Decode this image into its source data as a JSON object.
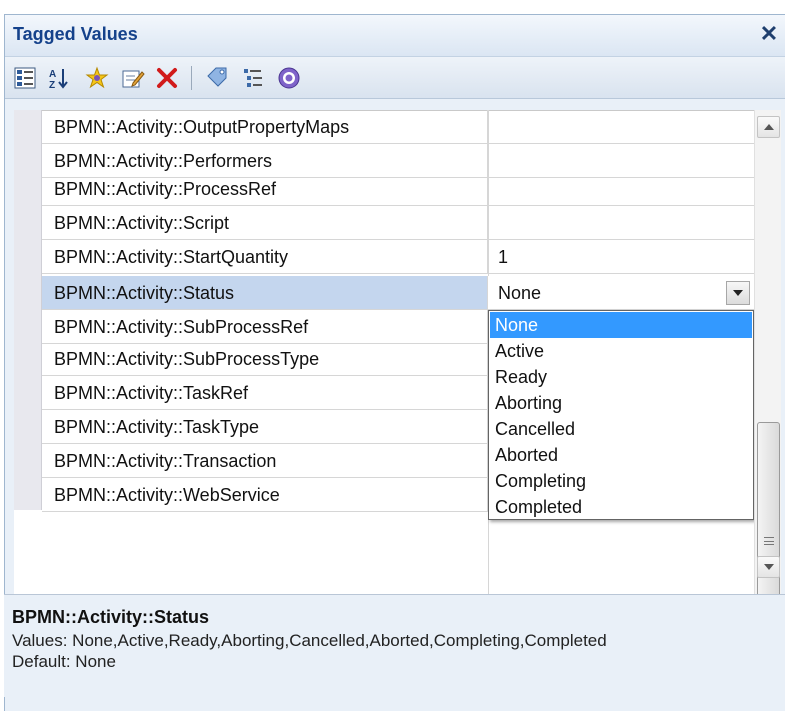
{
  "window": {
    "title": "Tagged Values",
    "close_icon": "close-icon"
  },
  "toolbar": {
    "buttons": [
      {
        "name": "categorized-view-icon"
      },
      {
        "name": "sort-alphabetical-icon"
      },
      {
        "name": "new-tag-icon"
      },
      {
        "name": "edit-tag-icon"
      },
      {
        "name": "delete-tag-icon"
      },
      {
        "name": "tag-properties-icon"
      },
      {
        "name": "show-inherited-icon"
      },
      {
        "name": "help-icon"
      }
    ]
  },
  "rows": [
    {
      "name": "BPMN::Activity::OutputPropertyMaps",
      "value": ""
    },
    {
      "name": "BPMN::Activity::Performers",
      "value": ""
    },
    {
      "name": "BPMN::Activity::ProcessRef",
      "value": ""
    },
    {
      "name": "BPMN::Activity::Script",
      "value": ""
    },
    {
      "name": "BPMN::Activity::StartQuantity",
      "value": "1"
    },
    {
      "name": "BPMN::Activity::Status",
      "value": "None"
    },
    {
      "name": "BPMN::Activity::SubProcessRef",
      "value": ""
    },
    {
      "name": "BPMN::Activity::SubProcessType",
      "value": ""
    },
    {
      "name": "BPMN::Activity::TaskRef",
      "value": ""
    },
    {
      "name": "BPMN::Activity::TaskType",
      "value": ""
    },
    {
      "name": "BPMN::Activity::Transaction",
      "value": ""
    },
    {
      "name": "BPMN::Activity::WebService",
      "value": ""
    }
  ],
  "status_combo": {
    "selected": "None"
  },
  "dropdown": {
    "options": [
      "None",
      "Active",
      "Ready",
      "Aborting",
      "Cancelled",
      "Aborted",
      "Completing",
      "Completed"
    ],
    "highlighted": "None"
  },
  "description": {
    "title": "BPMN::Activity::Status",
    "values_line": "Values: None,Active,Ready,Aborting,Cancelled,Aborted,Completing,Completed",
    "default_line": "Default: None"
  },
  "colors": {
    "title_text": "#15428b",
    "selected_row": "#c4d6ee",
    "highlight": "#3399ff"
  }
}
